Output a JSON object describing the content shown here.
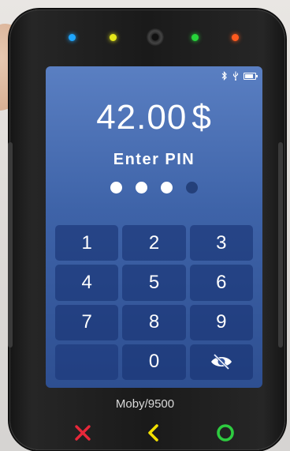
{
  "device": {
    "model_label": "Moby/9500",
    "leds": [
      {
        "name": "blue",
        "color": "#1ea6ff"
      },
      {
        "name": "yellow",
        "color": "#e6e81a"
      },
      {
        "name": "green",
        "color": "#27d43a"
      },
      {
        "name": "red",
        "color": "#ff5a1e"
      }
    ],
    "hardware_keys": [
      {
        "name": "cancel",
        "icon": "x-icon",
        "color": "#e8283a"
      },
      {
        "name": "back",
        "icon": "chevron-left-icon",
        "color": "#f2e000"
      },
      {
        "name": "confirm",
        "icon": "circle-icon",
        "color": "#2ecc40"
      }
    ]
  },
  "screen": {
    "status_icons": [
      "bluetooth-icon",
      "usb-icon",
      "battery-icon"
    ],
    "battery_level": 0.85,
    "amount": "42.00",
    "currency_symbol": "$",
    "prompt": "Enter PIN",
    "pin_length": 4,
    "pin_entered": 3,
    "keypad": [
      "1",
      "2",
      "3",
      "4",
      "5",
      "6",
      "7",
      "8",
      "9",
      "",
      "0",
      "hide-icon"
    ]
  },
  "colors": {
    "screen_top": "#5a7fc2",
    "screen_bottom": "#2e4f91"
  }
}
